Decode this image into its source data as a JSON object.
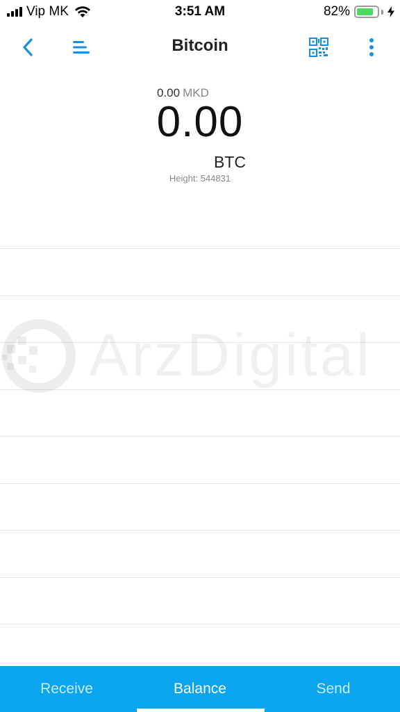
{
  "status_bar": {
    "carrier": "Vip MK",
    "time": "3:51 AM",
    "battery_percent": "82%",
    "battery_level": 0.82
  },
  "nav": {
    "title": "Bitcoin",
    "icons": [
      "back-chevron-icon",
      "menu-lines-icon",
      "qr-code-icon",
      "more-vertical-icon"
    ],
    "accent_color": "#1a8fe0"
  },
  "balance": {
    "fiat_amount": "0.00",
    "fiat_currency": "MKD",
    "crypto_amount": "0.00",
    "crypto_unit": "BTC",
    "height_label": "Height: 544831"
  },
  "watermark": {
    "text": "ArzDigital"
  },
  "transactions": {
    "row_count": 9
  },
  "tabs": [
    {
      "label": "Receive"
    },
    {
      "label": "Balance"
    },
    {
      "label": "Send"
    }
  ],
  "tab_bar_color": "#0aa4ef",
  "active_tab": "Balance"
}
